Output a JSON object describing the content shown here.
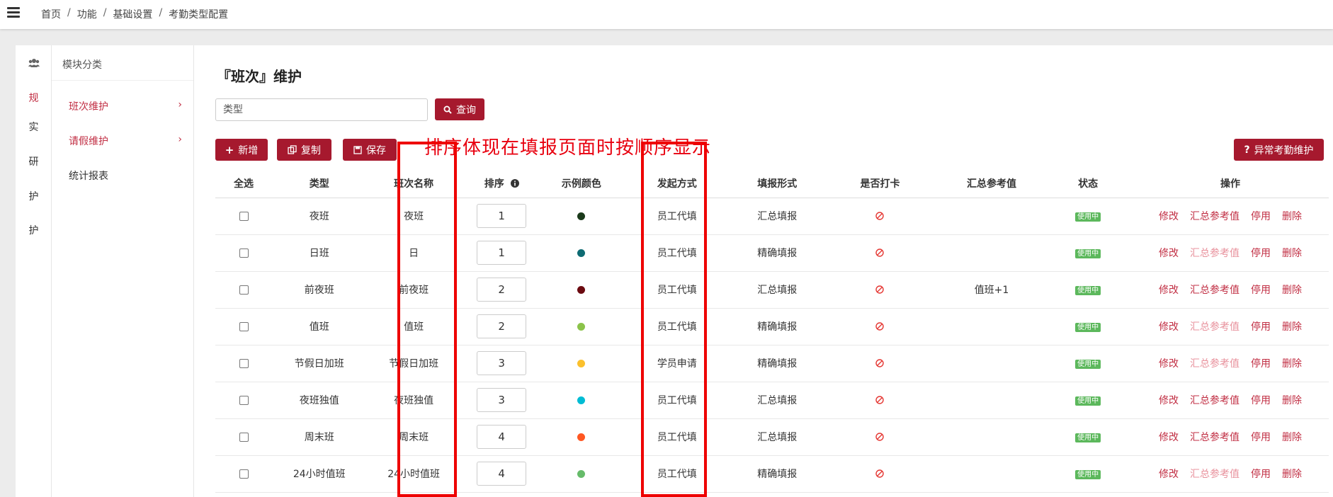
{
  "breadcrumb": [
    "首页",
    "功能",
    "基础设置",
    "考勤类型配置"
  ],
  "left_rail": [
    "规",
    "实",
    "研",
    "护",
    "护"
  ],
  "subnav": {
    "head": "模块分类",
    "items": [
      {
        "label": "班次维护",
        "chevron": "›",
        "active": true
      },
      {
        "label": "请假维护",
        "chevron": "›",
        "active": true
      },
      {
        "label": "统计报表",
        "chevron": "",
        "active": false
      }
    ]
  },
  "page_title": "『班次』维护",
  "search": {
    "value": "类型",
    "button": "查询"
  },
  "toolbar": {
    "add": "新增",
    "copy": "复制",
    "save": "保存",
    "abnormal": "异常考勤维护"
  },
  "annotation": "排序体现在填报页面时按顺序显示",
  "table": {
    "headers": [
      "全选",
      "类型",
      "班次名称",
      "排序",
      "示例颜色",
      "发起方式",
      "填报形式",
      "是否打卡",
      "汇总参考值",
      "状态",
      "操作"
    ],
    "rows": [
      {
        "type": "夜班",
        "name": "夜班",
        "order": "1",
        "color": "#1a3a1a",
        "initiator": "员工代填",
        "form": "汇总填报",
        "ref": "",
        "status": "使用中",
        "ref_dim": false
      },
      {
        "type": "日班",
        "name": "日",
        "order": "1",
        "color": "#0e6b73",
        "initiator": "员工代填",
        "form": "精确填报",
        "ref": "",
        "status": "使用中",
        "ref_dim": true
      },
      {
        "type": "前夜班",
        "name": "前夜班",
        "order": "2",
        "color": "#6b0a10",
        "initiator": "员工代填",
        "form": "汇总填报",
        "ref": "值班+1",
        "status": "使用中",
        "ref_dim": false
      },
      {
        "type": "值班",
        "name": "值班",
        "order": "2",
        "color": "#8bc34a",
        "initiator": "员工代填",
        "form": "精确填报",
        "ref": "",
        "status": "使用中",
        "ref_dim": true
      },
      {
        "type": "节假日加班",
        "name": "节假日加班",
        "order": "3",
        "color": "#fbc02d",
        "initiator": "学员申请",
        "form": "精确填报",
        "ref": "",
        "status": "使用中",
        "ref_dim": true
      },
      {
        "type": "夜班独值",
        "name": "夜班独值",
        "order": "3",
        "color": "#00bcd4",
        "initiator": "员工代填",
        "form": "汇总填报",
        "ref": "",
        "status": "使用中",
        "ref_dim": false
      },
      {
        "type": "周末班",
        "name": "周末班",
        "order": "4",
        "color": "#ff5722",
        "initiator": "员工代填",
        "form": "汇总填报",
        "ref": "",
        "status": "使用中",
        "ref_dim": false
      },
      {
        "type": "24小时值班",
        "name": "24小时值班",
        "order": "4",
        "color": "#66bb6a",
        "initiator": "员工代填",
        "form": "精确填报",
        "ref": "",
        "status": "使用中",
        "ref_dim": true
      }
    ],
    "ops": [
      "修改",
      "汇总参考值",
      "停用",
      "删除"
    ]
  }
}
